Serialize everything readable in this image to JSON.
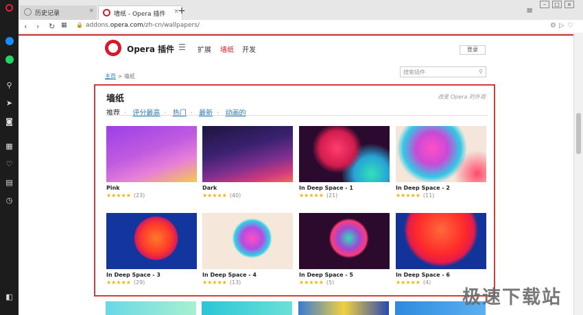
{
  "tabs": [
    {
      "label": "历史记录",
      "close": "×"
    },
    {
      "label": "墙纸 - Opera 插件",
      "close": "×"
    }
  ],
  "new_tab": "+",
  "address": {
    "prefix": "addons.",
    "domain": "opera.com",
    "path": "/zh-cn/wallpapers/"
  },
  "brand": "Opera 插件",
  "nav": {
    "extensions": "扩展",
    "wallpapers": "墙纸",
    "develop": "开发"
  },
  "login": "登录",
  "breadcrumb": {
    "home": "主页",
    "sep": " > ",
    "current": "墙纸"
  },
  "search": {
    "placeholder": "搜索插件"
  },
  "wallpapers": {
    "title": "墙纸",
    "customize_link": "改变 Opera 的外观",
    "filters": {
      "featured": "推荐",
      "top_rated": "评分最高",
      "popular": "热门",
      "newest": "最新",
      "animated": "动画的"
    },
    "items": [
      {
        "name": "Pink",
        "count": "(23)"
      },
      {
        "name": "Dark",
        "count": "(40)"
      },
      {
        "name": "In Deep Space - 1",
        "count": "(21)"
      },
      {
        "name": "In Deep Space - 2",
        "count": "(11)"
      },
      {
        "name": "In Deep Space - 3",
        "count": "(29)"
      },
      {
        "name": "In Deep Space - 4",
        "count": "(13)"
      },
      {
        "name": "In Deep Space - 5",
        "count": "(5)"
      },
      {
        "name": "In Deep Space - 6",
        "count": "(4)"
      }
    ],
    "stars": "★★★★★"
  },
  "watermark": "极速下载站",
  "colors": {
    "accent": "#d5192b",
    "link": "#2a7ab0",
    "highlight_border": "#d53a3a"
  }
}
